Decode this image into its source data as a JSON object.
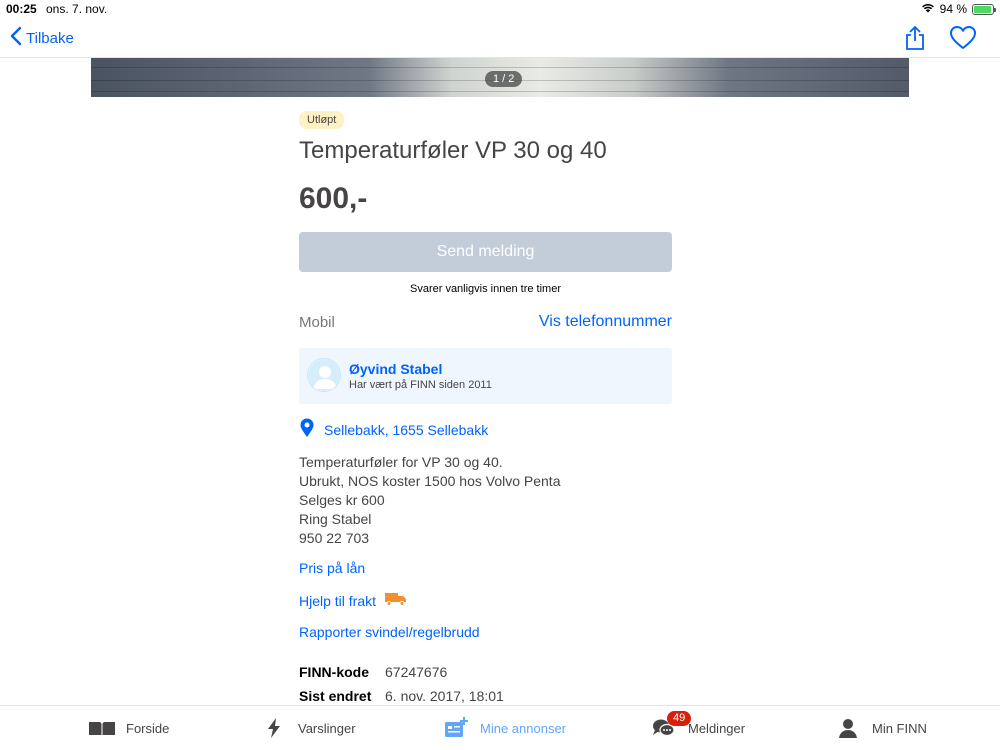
{
  "status_bar": {
    "time": "00:25",
    "date": "ons. 7. nov.",
    "battery_label": "94 %",
    "battery_level": 0.94,
    "icons": [
      "wifi-icon",
      "battery-icon"
    ]
  },
  "nav": {
    "back_label": "Tilbake",
    "icons": [
      "chevron-left-icon",
      "share-icon",
      "heart-icon"
    ]
  },
  "gallery": {
    "counter": "1 / 2"
  },
  "ad": {
    "status_tag": "Utløpt",
    "title": "Temperaturføler VP 30 og 40",
    "price": "600,-",
    "send_button": "Send melding",
    "response_note": "Svarer vanligvis innen tre timer",
    "phone_label": "Mobil",
    "phone_link": "Vis telefonnummer"
  },
  "seller": {
    "name": "Øyvind Stabel",
    "since": "Har vært på FINN siden 2011"
  },
  "location": {
    "text": "Sellebakk, 1655 Sellebakk"
  },
  "description": [
    "Temperaturføler for VP 30 og 40.",
    "Ubrukt, NOS koster 1500 hos Volvo Penta",
    "Selges kr 600",
    "Ring Stabel",
    "950 22 703"
  ],
  "links": {
    "loan": "Pris på lån",
    "shipping": "Hjelp til frakt",
    "report": "Rapporter svindel/regelbrudd"
  },
  "meta": {
    "code_label": "FINN-kode",
    "code_value": "67247676",
    "edited_label": "Sist endret",
    "edited_value": "6. nov. 2017, 18:01"
  },
  "tab_bar": {
    "home": "Forside",
    "alerts": "Varslinger",
    "my_ads": "Mine annonser",
    "messages": "Meldinger",
    "messages_badge": "49",
    "profile": "Min FINN"
  },
  "colors": {
    "link_blue": "#0063fb",
    "active_tab": "#62a6f9",
    "disabled_button": "#c3ccd9",
    "badge_red": "#d91f0a",
    "tag_yellow": "#fff1c4",
    "seller_card": "#f0f6fe"
  }
}
